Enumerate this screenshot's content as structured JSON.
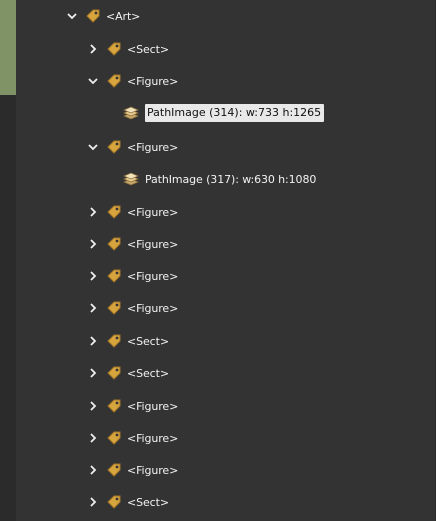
{
  "colors": {
    "accent": "#7f9367",
    "panel_background": "#333333",
    "tag_icon": "#d8a43d",
    "selection": "#e9e9e9"
  },
  "tree": {
    "root": {
      "label": "<Art>",
      "state": "expanded",
      "icon": "tag-icon"
    },
    "items": [
      {
        "label": "<Sect>",
        "state": "collapsed",
        "icon": "tag-icon"
      },
      {
        "label": "<Figure>",
        "state": "expanded",
        "icon": "tag-icon"
      },
      {
        "label": "PathImage (314): w:733 h:1265",
        "state": "selected",
        "icon": "image-icon"
      },
      {
        "label": "<Figure>",
        "state": "expanded",
        "icon": "tag-icon"
      },
      {
        "label": "PathImage (317): w:630 h:1080",
        "state": "leaf",
        "icon": "image-icon"
      },
      {
        "label": "<Figure>",
        "state": "collapsed",
        "icon": "tag-icon"
      },
      {
        "label": "<Figure>",
        "state": "collapsed",
        "icon": "tag-icon"
      },
      {
        "label": "<Figure>",
        "state": "collapsed",
        "icon": "tag-icon"
      },
      {
        "label": "<Figure>",
        "state": "collapsed",
        "icon": "tag-icon"
      },
      {
        "label": "<Sect>",
        "state": "collapsed",
        "icon": "tag-icon"
      },
      {
        "label": "<Sect>",
        "state": "collapsed",
        "icon": "tag-icon"
      },
      {
        "label": "<Figure>",
        "state": "collapsed",
        "icon": "tag-icon"
      },
      {
        "label": "<Figure>",
        "state": "collapsed",
        "icon": "tag-icon"
      },
      {
        "label": "<Figure>",
        "state": "collapsed",
        "icon": "tag-icon"
      },
      {
        "label": "<Sect>",
        "state": "collapsed",
        "icon": "tag-icon"
      }
    ]
  }
}
